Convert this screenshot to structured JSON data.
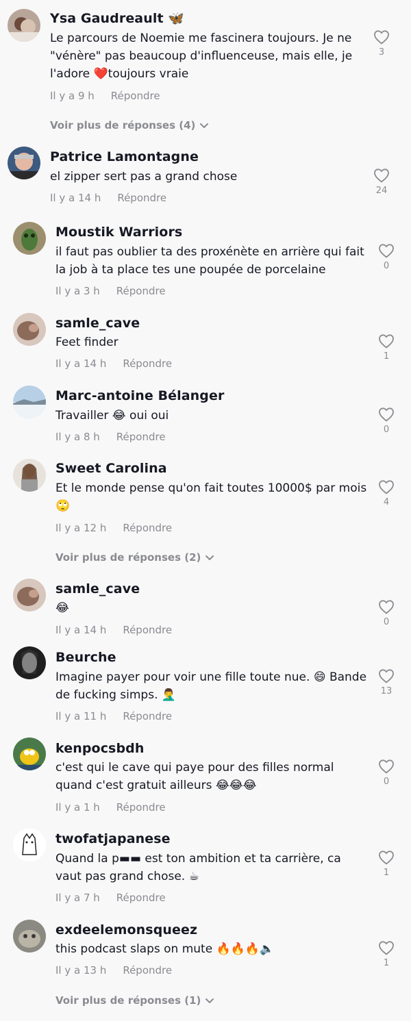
{
  "comments": [
    {
      "username": "Ysa Gaudreault 🦋",
      "text": "Le parcours de Noemie me fascinera toujours. Je ne \"vénère\" pas beaucoup d'influenceuse, mais elle, je l'adore ❤️toujours vraie",
      "time": "Il y a 9 h",
      "reply": "Répondre",
      "likes": "3",
      "more_replies": "Voir plus de réponses (4)"
    },
    {
      "username": "Patrice Lamontagne",
      "text": "el zipper sert pas a grand chose",
      "time": "Il y a 14 h",
      "reply": "Répondre",
      "likes": "24"
    },
    {
      "username": "Moustik Warriors",
      "text": "il faut pas oublier ta des proxénète en arrière qui fait la job à ta place tes une poupée de porcelaine",
      "time": "Il y a 3 h",
      "reply": "Répondre",
      "likes": "0"
    },
    {
      "username": "samle_cave",
      "text": "Feet finder",
      "time": "Il y a 14 h",
      "reply": "Répondre",
      "likes": "1"
    },
    {
      "username": "Marc-antoine Bélanger",
      "text": "Travailler 😂 oui oui",
      "time": "Il y a 8 h",
      "reply": "Répondre",
      "likes": "0"
    },
    {
      "username": "Sweet Carolina",
      "text": "Et le monde pense qu'on fait toutes 10000$ par mois 🙄",
      "time": "Il y a 12 h",
      "reply": "Répondre",
      "likes": "4",
      "more_replies": "Voir plus de réponses (2)"
    },
    {
      "username": "samle_cave",
      "text": "😂",
      "time": "Il y a 14 h",
      "reply": "Répondre",
      "likes": "0"
    },
    {
      "username": "Beurche",
      "text": "Imagine payer pour voir une fille toute nue. 😄 Bande de fucking simps. 🤦‍♂️",
      "time": "Il y a 11 h",
      "reply": "Répondre",
      "likes": "13"
    },
    {
      "username": "kenpocsbdh",
      "text": "c'est qui le cave qui paye pour des filles normal quand c'est gratuit ailleurs 😂😂😂",
      "time": "Il y a 1 h",
      "reply": "Répondre",
      "likes": "0"
    },
    {
      "username": "twofatjapanese",
      "text": "Quand la p▬▬ est ton ambition et ta carrière, ca vaut pas grand chose. ☕",
      "time": "Il y a 7 h",
      "reply": "Répondre",
      "likes": "1"
    },
    {
      "username": "exdeelemonsqueez",
      "text": "this podcast slaps on mute 🔥🔥🔥🔈",
      "time": "Il y a 13 h",
      "reply": "Répondre",
      "likes": "1",
      "more_replies": "Voir plus de réponses (1)"
    }
  ],
  "icons": {
    "like": "heart-outline-icon",
    "expand": "chevron-down-icon"
  },
  "colors": {
    "background": "#f8f8f8",
    "text": "#161823",
    "muted": "#8a8b91"
  }
}
